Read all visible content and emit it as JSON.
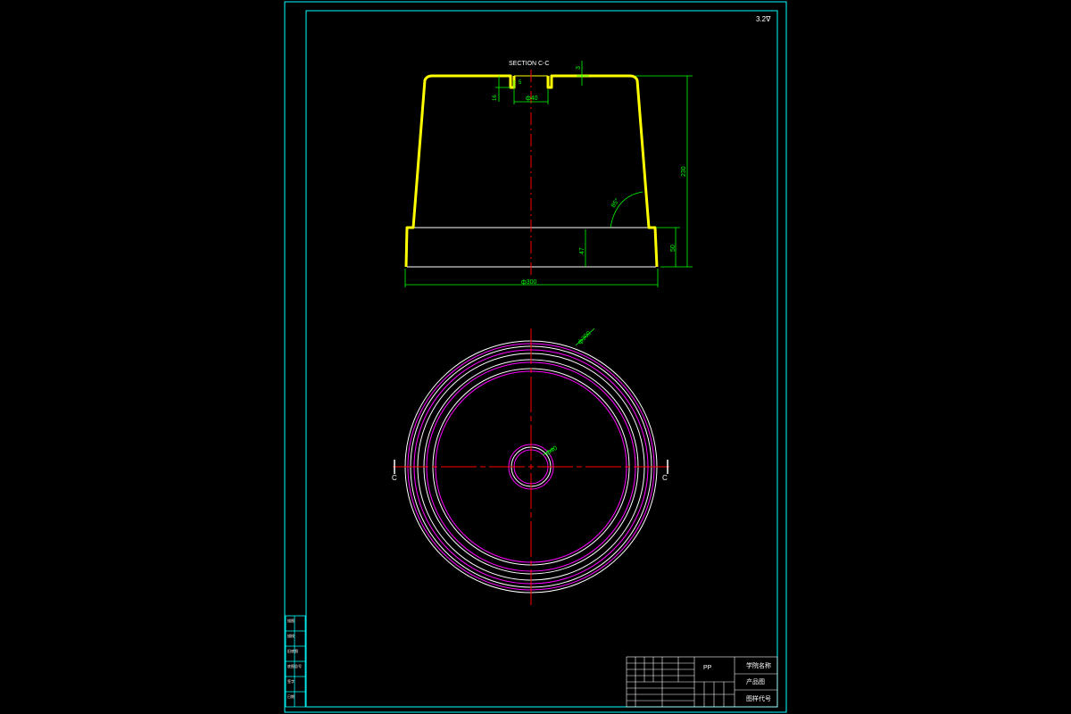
{
  "colors": {
    "background": "#000000",
    "frame": "#00ffff",
    "outline": "#ffff00",
    "dimension": "#00ff00",
    "centerline": "#ff0000",
    "circle_outer": "#ff00ff",
    "circle_inner": "#ffffff",
    "text": "#ffffff"
  },
  "corner_mark": "3.2∇",
  "section_view": {
    "title": "SECTION C-C",
    "dims": {
      "top_thickness": "3",
      "slot_depth": "5",
      "slot_height": "16",
      "hole_diameter": "ф40",
      "total_height": "230",
      "angle": "85°",
      "base_inner_height": "47",
      "base_height": "50",
      "base_diameter": "ф300"
    }
  },
  "plan_view": {
    "outer_diameter": "ф300",
    "hole_diameter": "ф40",
    "section_mark_left": "C",
    "section_mark_right": "C"
  },
  "title_block": {
    "material": "PP",
    "school": "学院名称",
    "part_name": "产品图",
    "drawing_no": "图样代号"
  },
  "side_strip": [
    "描图",
    "描校",
    "旧底图",
    "底图总号",
    "签字",
    "日期"
  ]
}
